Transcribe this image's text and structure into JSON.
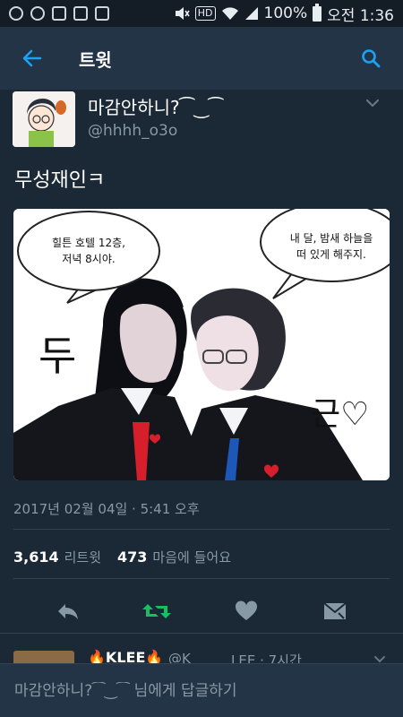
{
  "status_bar": {
    "left_icons": [
      "g-app-icon",
      "o-app-icon",
      "gallery-icon",
      "store-icon",
      "check-icon"
    ],
    "hd": "HD",
    "battery_text": "100%",
    "time": "오전 1:36"
  },
  "app_bar": {
    "title": "트윗"
  },
  "tweet": {
    "author_name": "마감안하니?⁀‿⁀",
    "author_handle": "@hhhh_o3o",
    "text": "무성재인ㅋ",
    "image": {
      "bubble_left_line1": "힐튼 호텔 12층,",
      "bubble_left_line2": "저녁 8시야.",
      "bubble_right_line1": "내 달, 밤새 하늘을",
      "bubble_right_line2": "떠 있게 해주지.",
      "sfx_left": "두",
      "sfx_right": "근♡"
    },
    "timestamp": "2017년 02월 04일 · 5:41 오후",
    "retweet_count": "3,614",
    "retweet_label": "리트윗",
    "like_count": "473",
    "like_label": "마음에 들어요"
  },
  "reply_preview": {
    "name": "🔥KLEE🔥",
    "handle": "@K",
    "meta": "LEE · 7시간"
  },
  "compose": {
    "placeholder": "마감안하니?⁀‿⁀ 님에게 답글하기"
  },
  "colors": {
    "background": "#1b2836",
    "app_bar": "#243447",
    "accent_blue": "#1da1f2",
    "retweet_green": "#17bf63",
    "muted": "#8899a6"
  }
}
